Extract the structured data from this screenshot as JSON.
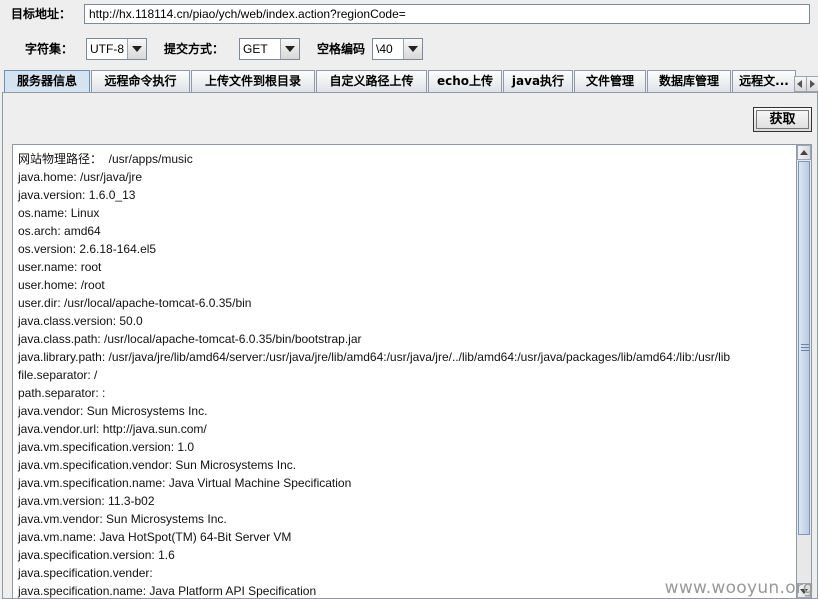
{
  "target": {
    "label": "目标地址：",
    "url": "http://hx.118114.cn/piao/ych/web/index.action?regionCode="
  },
  "options": {
    "charset_label": "字符集：",
    "charset_value": "UTF-8",
    "method_label": "提交方式：",
    "method_value": "GET",
    "space_label": "空格编码",
    "space_value": "\\40"
  },
  "tabs": [
    {
      "label": "服务器信息",
      "active": true
    },
    {
      "label": "远程命令执行"
    },
    {
      "label": "上传文件到根目录"
    },
    {
      "label": "自定义路径上传"
    },
    {
      "label": "echo上传"
    },
    {
      "label": "java执行"
    },
    {
      "label": "文件管理"
    },
    {
      "label": "数据库管理"
    },
    {
      "label": "远程文..."
    }
  ],
  "fetch_button": "获取",
  "output_lines": [
    "网站物理路径：  /usr/apps/music",
    "java.home: /usr/java/jre",
    "java.version: 1.6.0_13",
    "os.name: Linux",
    "os.arch: amd64",
    "os.version: 2.6.18-164.el5",
    "user.name: root",
    "user.home: /root",
    "user.dir: /usr/local/apache-tomcat-6.0.35/bin",
    "java.class.version: 50.0",
    "java.class.path: /usr/local/apache-tomcat-6.0.35/bin/bootstrap.jar",
    "java.library.path: /usr/java/jre/lib/amd64/server:/usr/java/jre/lib/amd64:/usr/java/jre/../lib/amd64:/usr/java/packages/lib/amd64:/lib:/usr/lib",
    "file.separator: /",
    "path.separator: :",
    "java.vendor: Sun Microsystems Inc.",
    "java.vendor.url: http://java.sun.com/",
    "java.vm.specification.version: 1.0",
    "java.vm.specification.vendor: Sun Microsystems Inc.",
    "java.vm.specification.name: Java Virtual Machine Specification",
    "java.vm.version: 11.3-b02",
    "java.vm.vendor: Sun Microsystems Inc.",
    "java.vm.name: Java HotSpot(TM) 64-Bit Server VM",
    "java.specification.version: 1.6",
    "java.specification.vender:",
    "java.specification.name: Java Platform API Specification"
  ],
  "watermark": "www.wooyun.org",
  "scrollbar_position": 0
}
